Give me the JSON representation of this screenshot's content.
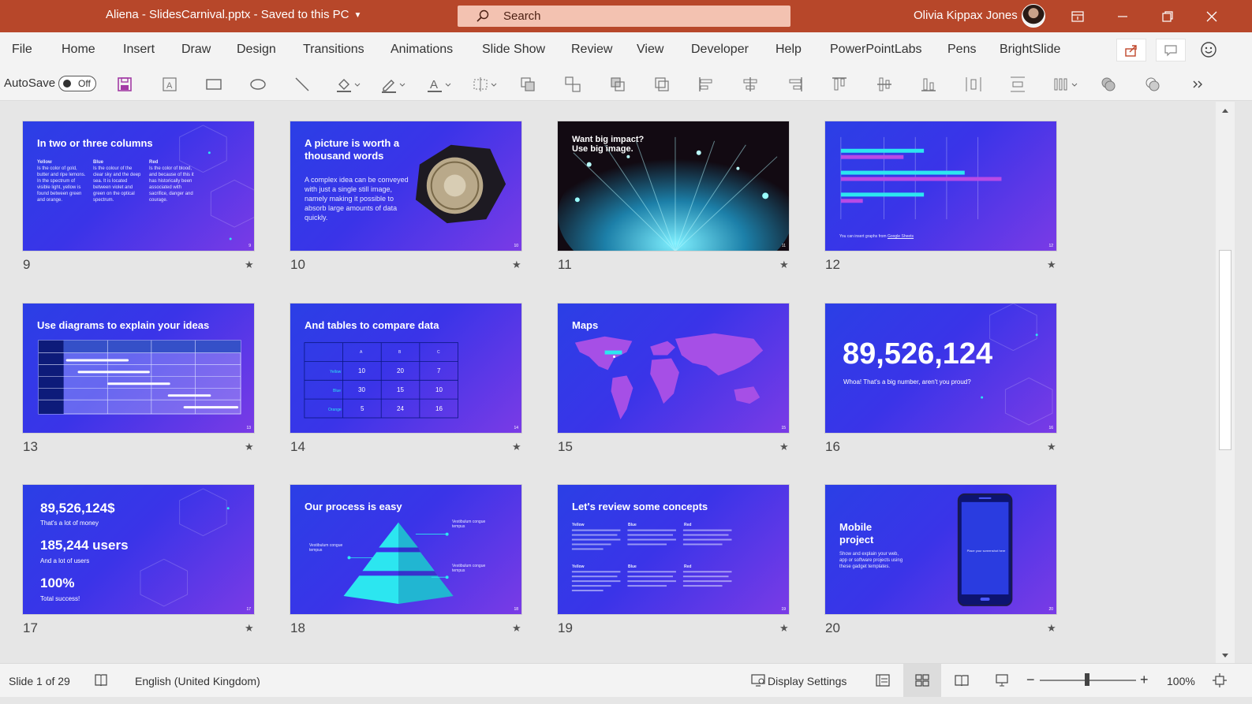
{
  "titlebar": {
    "document_title": "Aliena - SlidesCarnival.pptx  -  Saved to this PC",
    "search_placeholder": "Search",
    "user_name": "Olivia Kippax Jones"
  },
  "ribbon": {
    "tabs": [
      "File",
      "Home",
      "Insert",
      "Draw",
      "Design",
      "Transitions",
      "Animations",
      "Slide Show",
      "Review",
      "View",
      "Developer",
      "Help",
      "PowerPointLabs",
      "Pens",
      "BrightSlide"
    ]
  },
  "toolbar": {
    "autosave_label": "AutoSave",
    "autosave_state": "Off"
  },
  "slides": [
    {
      "num": "9",
      "title": "In two or three columns",
      "cols": [
        {
          "h": "Yellow",
          "t": "Is the color of gold, butter and ripe lemons. In the spectrum of visible light, yellow is found between green and orange."
        },
        {
          "h": "Blue",
          "t": "Is the colour of the clear sky and the deep sea. It is located between violet and green on the optical spectrum."
        },
        {
          "h": "Red",
          "t": "Is the color of blood, and because of this it has historically been associated with sacrifice, danger and courage."
        }
      ],
      "page": "9"
    },
    {
      "num": "10",
      "title": "A picture is worth a thousand words",
      "body": "A complex idea can be conveyed with just a single still image, namely making it possible to absorb large amounts of data quickly.",
      "page": "10"
    },
    {
      "num": "11",
      "title": "Want big impact? Use big image.",
      "page": "11"
    },
    {
      "num": "12",
      "caption": "You can insert graphs from ",
      "link": "Google Sheets",
      "page": "12"
    },
    {
      "num": "13",
      "title": "Use diagrams to explain your ideas",
      "page": "13"
    },
    {
      "num": "14",
      "title": "And tables to compare data",
      "headers": [
        "A",
        "B",
        "C"
      ],
      "rows": [
        {
          "label": "Yellow",
          "cells": [
            "10",
            "20",
            "7"
          ]
        },
        {
          "label": "Blue",
          "cells": [
            "30",
            "15",
            "10"
          ]
        },
        {
          "label": "Orange",
          "cells": [
            "5",
            "24",
            "16"
          ]
        }
      ],
      "page": "14"
    },
    {
      "num": "15",
      "title": "Maps",
      "page": "15"
    },
    {
      "num": "16",
      "big": "89,526,124",
      "sub": "Whoa! That's a big number, aren't you proud?",
      "page": "16"
    },
    {
      "num": "17",
      "stats": [
        {
          "v": "89,526,124$",
          "l": "That's a lot of money"
        },
        {
          "v": "185,244 users",
          "l": "And a lot of users"
        },
        {
          "v": "100%",
          "l": "Total success!"
        }
      ],
      "page": "17"
    },
    {
      "num": "18",
      "title": "Our process is easy",
      "labels": [
        "Vestibulum congue tempus",
        "Vestibulum congue tempus",
        "Vestibulum congue tempus"
      ],
      "page": "18"
    },
    {
      "num": "19",
      "title": "Let's review some concepts",
      "heads": [
        "Yellow",
        "Blue",
        "Red",
        "Yellow",
        "Blue",
        "Red"
      ],
      "page": "19"
    },
    {
      "num": "20",
      "title": "Mobile project",
      "body": "Show and explain your web, app or software projects using these gadget templates.",
      "screen": "Place your screenshot here",
      "page": "20"
    }
  ],
  "statusbar": {
    "slide_info": "Slide 1 of 29",
    "language": "English (United Kingdom)",
    "display_settings": "Display Settings",
    "zoom": "100%"
  },
  "colors": {
    "titlebar": "#b7472a",
    "slide_blue": "#2b3fe6",
    "slide_purple": "#7a3be6",
    "accent_cyan": "#2ce6f0"
  }
}
